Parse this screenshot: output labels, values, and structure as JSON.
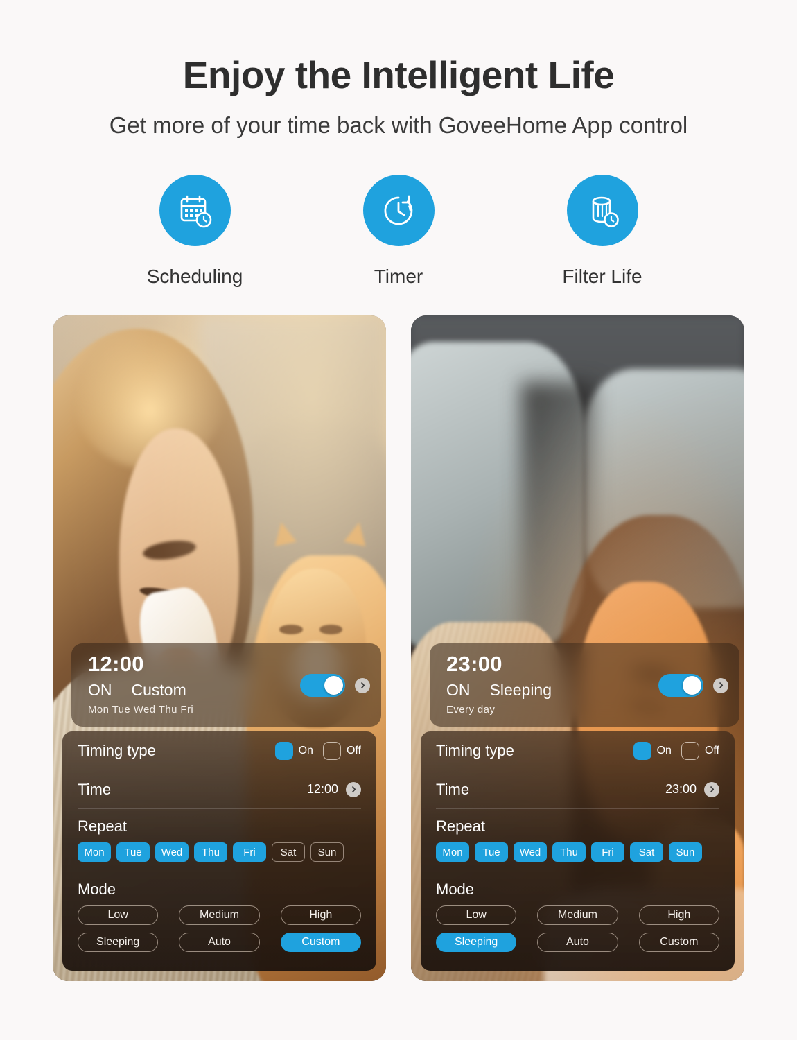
{
  "header": {
    "title": "Enjoy the Intelligent Life",
    "subtitle": "Get more of your time back with GoveeHome App control"
  },
  "features": [
    {
      "label": "Scheduling",
      "icon": "calendar-clock-icon"
    },
    {
      "label": "Timer",
      "icon": "clock-refresh-icon"
    },
    {
      "label": "Filter Life",
      "icon": "filter-clock-icon"
    }
  ],
  "colors": {
    "accent": "#1fa2de",
    "background": "#faf8f8",
    "title": "#2e2e2e",
    "panel": "#2b1d14"
  },
  "cards": [
    {
      "photo_alt": "Woman sneezing into a tissue beside an orange cat in warm sunlight",
      "schedule": {
        "time": "12:00",
        "state": "ON",
        "mode": "Custom",
        "days_summary": "Mon  Tue  Wed  Thu  Fri",
        "toggle_on": true
      },
      "settings": {
        "timing_type_label": "Timing type",
        "timing_on_label": "On",
        "timing_off_label": "Off",
        "timing_selected": "On",
        "time_label": "Time",
        "time_value": "12:00",
        "repeat_label": "Repeat",
        "days": [
          {
            "label": "Mon",
            "selected": true
          },
          {
            "label": "Tue",
            "selected": true
          },
          {
            "label": "Wed",
            "selected": true
          },
          {
            "label": "Thu",
            "selected": true
          },
          {
            "label": "Fri",
            "selected": true
          },
          {
            "label": "Sat",
            "selected": false
          },
          {
            "label": "Sun",
            "selected": false
          }
        ],
        "mode_label": "Mode",
        "modes": [
          {
            "label": "Low",
            "selected": false
          },
          {
            "label": "Medium",
            "selected": false
          },
          {
            "label": "High",
            "selected": false
          },
          {
            "label": "Sleeping",
            "selected": false
          },
          {
            "label": "Auto",
            "selected": false
          },
          {
            "label": "Custom",
            "selected": true
          }
        ]
      }
    },
    {
      "photo_alt": "Woman sleeping on a pillow lit by warm amber light",
      "schedule": {
        "time": "23:00",
        "state": "ON",
        "mode": "Sleeping",
        "days_summary": "Every day",
        "toggle_on": true
      },
      "settings": {
        "timing_type_label": "Timing type",
        "timing_on_label": "On",
        "timing_off_label": "Off",
        "timing_selected": "On",
        "time_label": "Time",
        "time_value": "23:00",
        "repeat_label": "Repeat",
        "days": [
          {
            "label": "Mon",
            "selected": true
          },
          {
            "label": "Tue",
            "selected": true
          },
          {
            "label": "Wed",
            "selected": true
          },
          {
            "label": "Thu",
            "selected": true
          },
          {
            "label": "Fri",
            "selected": true
          },
          {
            "label": "Sat",
            "selected": true
          },
          {
            "label": "Sun",
            "selected": true
          }
        ],
        "mode_label": "Mode",
        "modes": [
          {
            "label": "Low",
            "selected": false
          },
          {
            "label": "Medium",
            "selected": false
          },
          {
            "label": "High",
            "selected": false
          },
          {
            "label": "Sleeping",
            "selected": true
          },
          {
            "label": "Auto",
            "selected": false
          },
          {
            "label": "Custom",
            "selected": false
          }
        ]
      }
    }
  ]
}
